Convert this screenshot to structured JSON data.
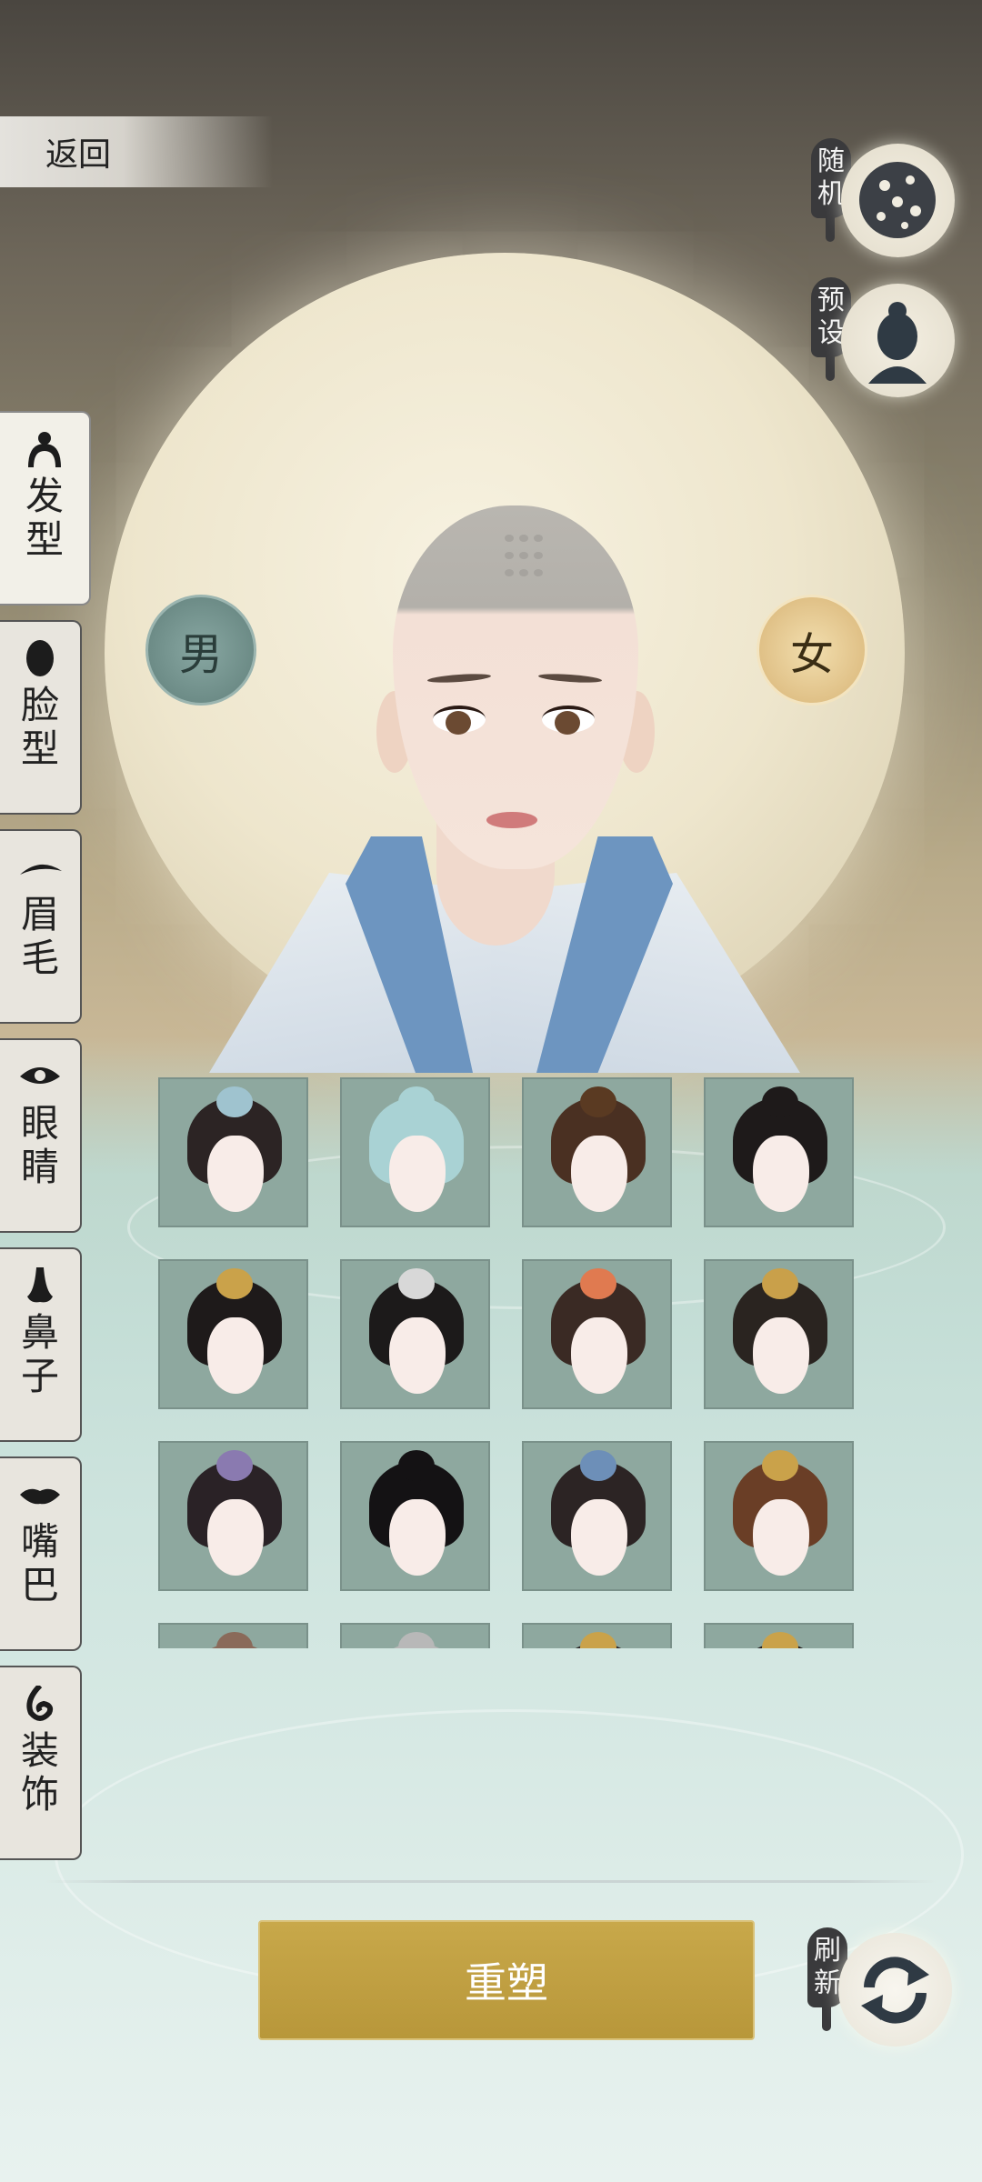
{
  "nav": {
    "back_label": "返回"
  },
  "actions": {
    "random": {
      "label": "随机",
      "icon": "dice-icon"
    },
    "preset": {
      "label": "预设",
      "icon": "silhouette-icon"
    },
    "refresh": {
      "label": "刷新",
      "icon": "refresh-icon"
    }
  },
  "gender": {
    "male_label": "男",
    "female_label": "女",
    "selected": "female"
  },
  "tabs": [
    {
      "label": "发型",
      "icon": "hair-icon",
      "active": true
    },
    {
      "label": "脸型",
      "icon": "face-icon",
      "active": false
    },
    {
      "label": "眉毛",
      "icon": "eyebrow-icon",
      "active": false
    },
    {
      "label": "眼睛",
      "icon": "eye-icon",
      "active": false
    },
    {
      "label": "鼻子",
      "icon": "nose-icon",
      "active": false
    },
    {
      "label": "嘴巴",
      "icon": "mouth-icon",
      "active": false
    },
    {
      "label": "装饰",
      "icon": "ornament-icon",
      "active": false
    }
  ],
  "hairstyles": [
    {
      "id": 1,
      "color": "#2c2424",
      "ornament": "#9fc3cf"
    },
    {
      "id": 2,
      "color": "#a9d2d4",
      "ornament": ""
    },
    {
      "id": 3,
      "color": "#4a3022",
      "ornament": "#5a3a22"
    },
    {
      "id": 4,
      "color": "#1e1a1a",
      "ornament": ""
    },
    {
      "id": 5,
      "color": "#1e1a1a",
      "ornament": "#caa24a"
    },
    {
      "id": 6,
      "color": "#1c1a1a",
      "ornament": "#d8d8d8"
    },
    {
      "id": 7,
      "color": "#3a2a24",
      "ornament": "#e07a50"
    },
    {
      "id": 8,
      "color": "#2a2420",
      "ornament": "#c9a04a"
    },
    {
      "id": 9,
      "color": "#2a2226",
      "ornament": "#8a7ab0"
    },
    {
      "id": 10,
      "color": "#141214",
      "ornament": ""
    },
    {
      "id": 11,
      "color": "#2c2424",
      "ornament": "#6d8fb8"
    },
    {
      "id": 12,
      "color": "#6a3e26",
      "ornament": "#caa24a"
    },
    {
      "id": 13,
      "color": "#8a6a5a",
      "ornament": ""
    },
    {
      "id": 14,
      "color": "#b8b8b8",
      "ornament": ""
    },
    {
      "id": 15,
      "color": "#2a2424",
      "ornament": "#caa24a"
    },
    {
      "id": 16,
      "color": "#1e1a1a",
      "ornament": "#caa24a"
    }
  ],
  "primary_action": {
    "label": "重塑",
    "color": "#bf9f42"
  }
}
